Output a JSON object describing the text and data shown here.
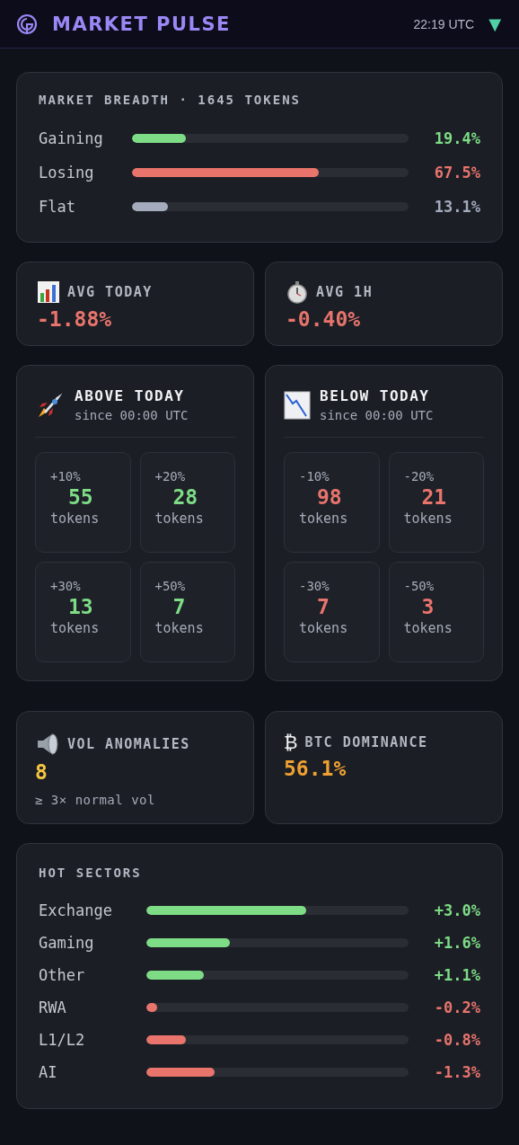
{
  "header": {
    "title": "MARKET PULSE",
    "time": "22:19 UTC",
    "indicator": "▼"
  },
  "breadth": {
    "title": "MARKET BREADTH · 1645 TOKENS",
    "rows": [
      {
        "label": "Gaining",
        "level": 0.194,
        "value": "19.4%",
        "color": "#7ddc85"
      },
      {
        "label": "Losing",
        "level": 0.675,
        "value": "67.5%",
        "color": "#e8746c"
      },
      {
        "label": "Flat",
        "level": 0.131,
        "value": "13.1%",
        "color": "#a3abbd"
      }
    ]
  },
  "averages": [
    {
      "label": "AVG TODAY",
      "value": "-1.88%",
      "color": "#e8746c"
    },
    {
      "label": "AVG 1H",
      "value": "-0.40%",
      "color": "#e8746c"
    }
  ],
  "thresholds": [
    {
      "title": "ABOVE TODAY",
      "subtitle": "since 00:00 UTC",
      "color": "#7ddc85",
      "tiles": [
        {
          "label": "+10%",
          "count": "55",
          "unit": "tokens"
        },
        {
          "label": "+20%",
          "count": "28",
          "unit": "tokens"
        },
        {
          "label": "+30%",
          "count": "13",
          "unit": "tokens"
        },
        {
          "label": "+50%",
          "count": "7",
          "unit": "tokens"
        }
      ]
    },
    {
      "title": "BELOW TODAY",
      "subtitle": "since 00:00 UTC",
      "color": "#e8746c",
      "tiles": [
        {
          "label": "-10%",
          "count": "98",
          "unit": "tokens"
        },
        {
          "label": "-20%",
          "count": "21",
          "unit": "tokens"
        },
        {
          "label": "-30%",
          "count": "7",
          "unit": "tokens"
        },
        {
          "label": "-50%",
          "count": "3",
          "unit": "tokens"
        }
      ]
    }
  ],
  "extras": [
    {
      "label": "VOL ANOMALIES",
      "value": "8",
      "note": "≥ 3× normal vol",
      "color": "#f5c542"
    },
    {
      "symbol": "₿",
      "label": "BTC DOMINANCE",
      "value": "56.1%",
      "color": "#f0a030"
    }
  ],
  "sectors": {
    "title": "HOT SECTORS",
    "rows": [
      {
        "label": "Exchange",
        "level": 0.61,
        "value": "+3.0%",
        "color": "#7ddc85"
      },
      {
        "label": "Gaming",
        "level": 0.32,
        "value": "+1.6%",
        "color": "#7ddc85"
      },
      {
        "label": "Other",
        "level": 0.22,
        "value": "+1.1%",
        "color": "#7ddc85"
      },
      {
        "label": "RWA",
        "level": 0.04,
        "value": "-0.2%",
        "color": "#e8746c"
      },
      {
        "label": "L1/L2",
        "level": 0.15,
        "value": "-0.8%",
        "color": "#e8746c"
      },
      {
        "label": "AI",
        "level": 0.26,
        "value": "-1.3%",
        "color": "#e8746c"
      }
    ]
  }
}
